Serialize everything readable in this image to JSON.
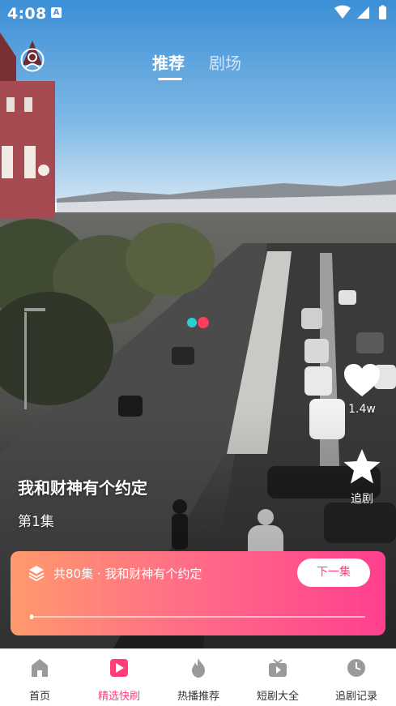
{
  "status_bar": {
    "time": "4:08",
    "notification_icon": "A"
  },
  "top_tabs": [
    {
      "label": "推荐",
      "active": true
    },
    {
      "label": "剧场",
      "active": false
    }
  ],
  "actions": {
    "like": {
      "icon": "heart-icon",
      "count": "1.4w"
    },
    "follow": {
      "icon": "star-icon",
      "label": "追剧"
    }
  },
  "drama": {
    "title": "我和财神有个约定",
    "episode": "第1集"
  },
  "episode_card": {
    "info": "共80集 · 我和财神有个约定",
    "next_button": "下一集",
    "progress": 0.0
  },
  "bottom_nav": [
    {
      "label": "首页",
      "icon": "home-icon",
      "active": false
    },
    {
      "label": "精选快刷",
      "icon": "play-icon",
      "active": true
    },
    {
      "label": "热播推荐",
      "icon": "fire-icon",
      "active": false
    },
    {
      "label": "短剧大全",
      "icon": "tv-icon",
      "active": false
    },
    {
      "label": "追剧记录",
      "icon": "clock-icon",
      "active": false
    }
  ],
  "colors": {
    "accent": "#ff3d78",
    "card_gradient_start": "#ff9a6b",
    "card_gradient_end": "#ff3f8f"
  }
}
